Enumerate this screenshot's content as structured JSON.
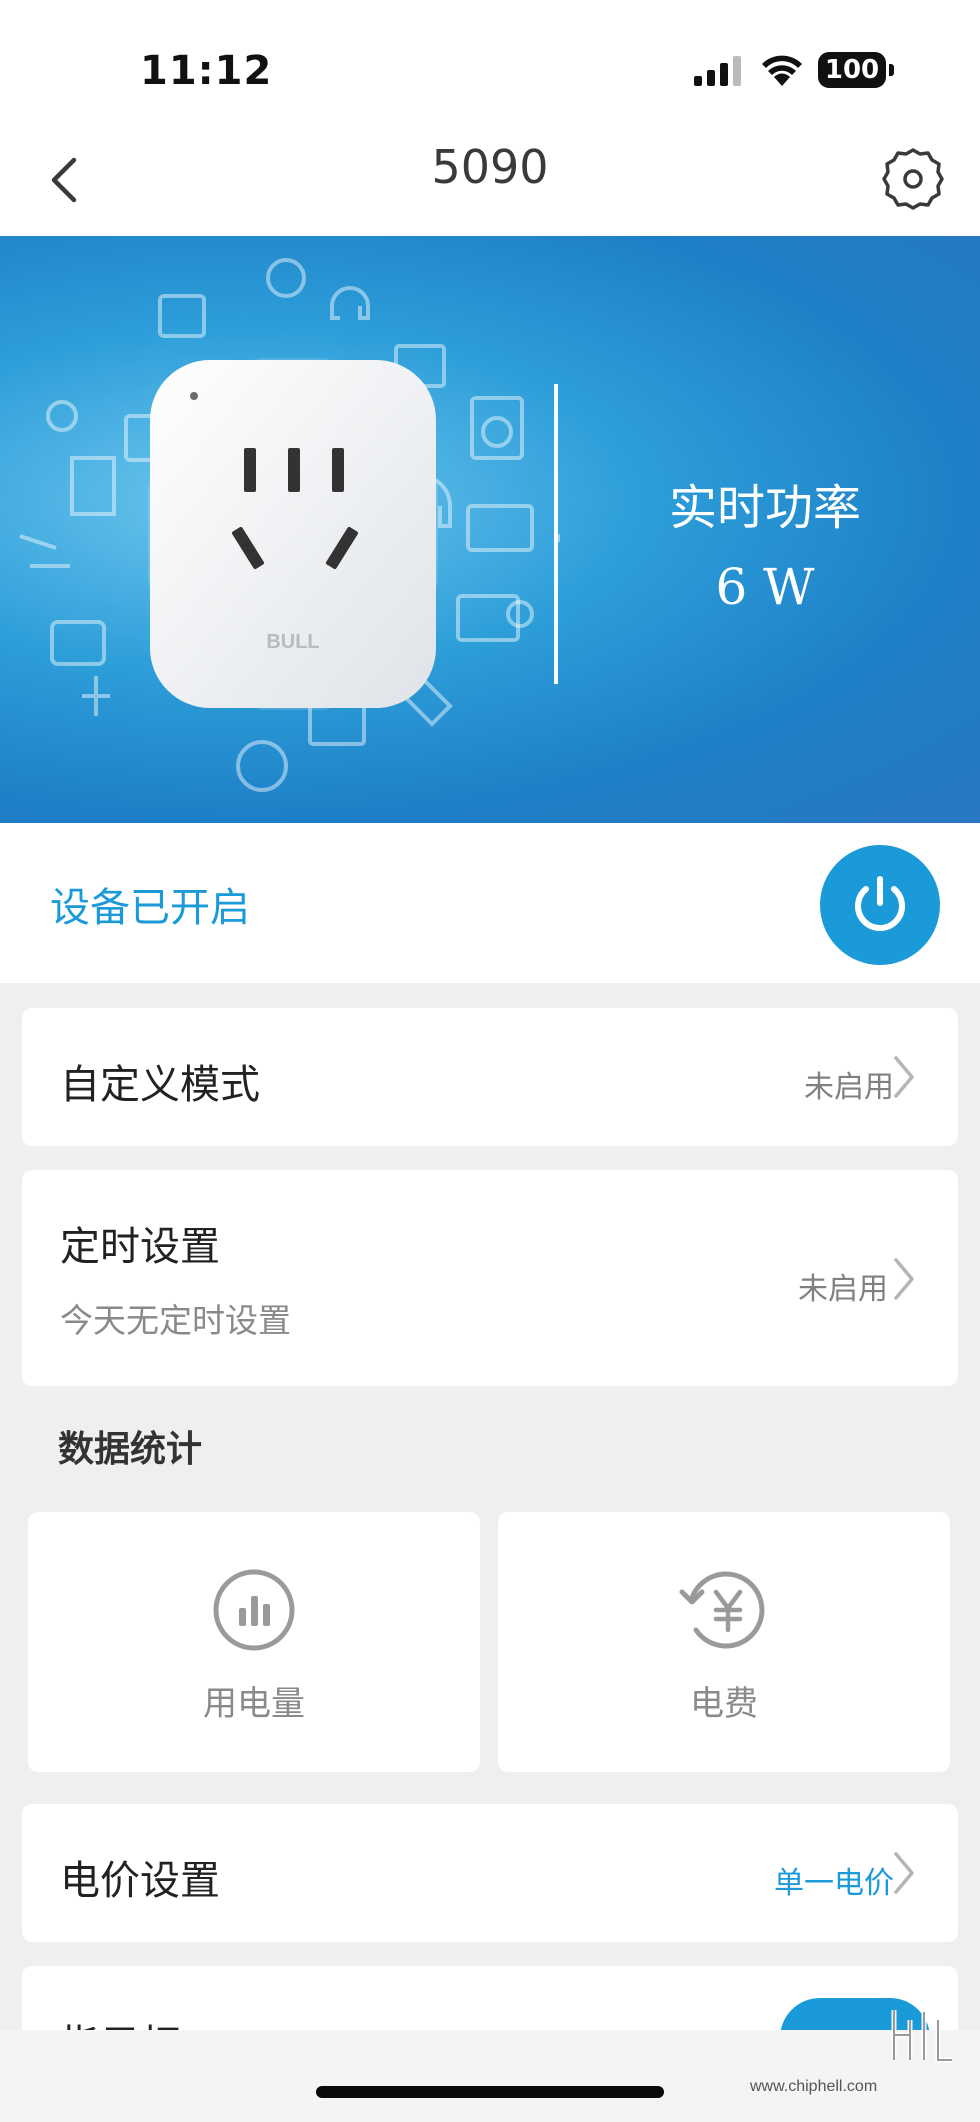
{
  "status_bar": {
    "time": "11:12",
    "battery": "100"
  },
  "header": {
    "title": "5090",
    "back_icon": "chevron-left-icon",
    "settings_icon": "gear-icon"
  },
  "banner": {
    "power_label": "实时功率",
    "power_value": "6 W",
    "brand": "BULL"
  },
  "device": {
    "status_text": "设备已开启",
    "power_icon": "power-icon",
    "accent": "#1a9ad9"
  },
  "cards": {
    "custom_mode": {
      "title": "自定义模式",
      "status": "未启用"
    },
    "timer": {
      "title": "定时设置",
      "subtitle": "今天无定时设置",
      "status": "未启用"
    },
    "price": {
      "title": "电价设置",
      "status": "单一电价"
    },
    "indicator": {
      "title": "指示灯"
    }
  },
  "stats": {
    "section_title": "数据统计",
    "usage": {
      "label": "用电量",
      "icon": "bar-chart-circle-icon"
    },
    "cost": {
      "label": "电费",
      "icon": "yen-refresh-icon"
    }
  },
  "watermark": {
    "text": "www.chiphell.com"
  }
}
